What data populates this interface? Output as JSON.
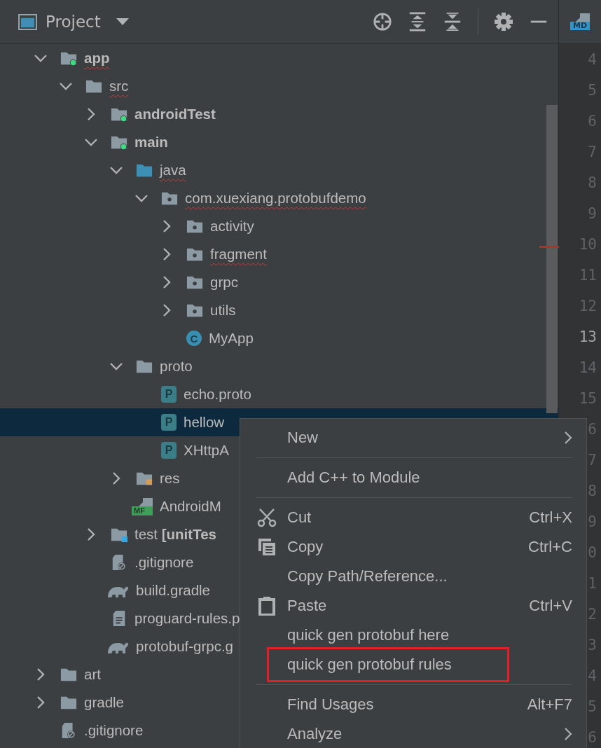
{
  "panel": {
    "title": "Project",
    "editor_tab_badge": "MD"
  },
  "tree": [
    {
      "label": "app",
      "kind": "module",
      "bold": true,
      "misspelled": true,
      "expanded": true,
      "selected": false,
      "children": [
        {
          "label": "src",
          "kind": "folder",
          "bold": false,
          "misspelled": true,
          "expanded": true,
          "selected": false,
          "children": [
            {
              "label": "androidTest",
              "kind": "module",
              "bold": true,
              "misspelled": false,
              "expanded": false,
              "selected": false
            },
            {
              "label": "main",
              "kind": "module",
              "bold": true,
              "misspelled": false,
              "expanded": true,
              "selected": false,
              "children": [
                {
                  "label": "java",
                  "kind": "source",
                  "bold": false,
                  "misspelled": true,
                  "expanded": true,
                  "selected": false,
                  "children": [
                    {
                      "label": "com.xuexiang.protobufdemo",
                      "kind": "package",
                      "bold": false,
                      "misspelled": true,
                      "expanded": true,
                      "selected": false,
                      "children": [
                        {
                          "label": "activity",
                          "kind": "package",
                          "bold": false,
                          "misspelled": false,
                          "expanded": false,
                          "selected": false
                        },
                        {
                          "label": "fragment",
                          "kind": "package",
                          "bold": false,
                          "misspelled": true,
                          "expanded": false,
                          "selected": false
                        },
                        {
                          "label": "grpc",
                          "kind": "package",
                          "bold": false,
                          "misspelled": false,
                          "expanded": false,
                          "selected": false
                        },
                        {
                          "label": "utils",
                          "kind": "package",
                          "bold": false,
                          "misspelled": false,
                          "expanded": false,
                          "selected": false
                        },
                        {
                          "label": "MyApp",
                          "kind": "class",
                          "badge": "C",
                          "bold": false,
                          "misspelled": false,
                          "selected": false
                        }
                      ]
                    }
                  ]
                },
                {
                  "label": "proto",
                  "kind": "folder",
                  "bold": false,
                  "misspelled": false,
                  "expanded": true,
                  "selected": false,
                  "children": [
                    {
                      "label": "echo.proto",
                      "kind": "proto",
                      "badge": "P",
                      "bold": false,
                      "misspelled": false,
                      "selected": false
                    },
                    {
                      "label": "hellow",
                      "kind": "proto",
                      "badge": "P",
                      "bold": false,
                      "misspelled": false,
                      "selected": true
                    },
                    {
                      "label": "XHttpA",
                      "kind": "proto",
                      "badge": "P",
                      "bold": false,
                      "misspelled": false,
                      "selected": false
                    }
                  ]
                },
                {
                  "label": "res",
                  "kind": "res",
                  "bold": false,
                  "misspelled": false,
                  "expanded": false,
                  "selected": false
                },
                {
                  "label": "AndroidM",
                  "kind": "manifest",
                  "badge": "MF",
                  "bold": false,
                  "misspelled": false,
                  "selected": false
                }
              ]
            },
            {
              "label": "test **[unitTes**",
              "kind": "test",
              "bold": false,
              "misspelled": false,
              "expanded": false,
              "selected": false
            },
            {
              "label": ".gitignore",
              "kind": "ignore",
              "bold": false,
              "misspelled": false,
              "selected": false
            },
            {
              "label": "build.gradle",
              "kind": "gradle",
              "bold": false,
              "misspelled": false,
              "selected": false
            },
            {
              "label": "proguard-rules.p",
              "kind": "text",
              "bold": false,
              "misspelled": false,
              "selected": false
            },
            {
              "label": "protobuf-grpc.g",
              "kind": "gradle",
              "bold": false,
              "misspelled": false,
              "selected": false
            }
          ]
        }
      ]
    },
    {
      "label": "art",
      "kind": "folder",
      "bold": false,
      "misspelled": false,
      "expanded": false,
      "selected": false
    },
    {
      "label": "gradle",
      "kind": "folder",
      "bold": false,
      "misspelled": false,
      "expanded": false,
      "selected": false
    },
    {
      "label": ".gitignore",
      "kind": "ignore",
      "bold": false,
      "misspelled": false,
      "selected": false
    }
  ],
  "gutter": [
    {
      "number": "4",
      "current": false
    },
    {
      "number": "5",
      "current": false
    },
    {
      "number": "6",
      "current": false
    },
    {
      "number": "7",
      "current": false
    },
    {
      "number": "8",
      "current": false
    },
    {
      "number": "9",
      "current": false
    },
    {
      "number": "10",
      "current": false
    },
    {
      "number": "11",
      "current": false
    },
    {
      "number": "12",
      "current": false
    },
    {
      "number": "13",
      "current": true
    },
    {
      "number": "14",
      "current": false
    },
    {
      "number": "15",
      "current": false
    },
    {
      "number": "6",
      "current": false
    },
    {
      "number": "7",
      "current": false
    },
    {
      "number": "8",
      "current": false
    },
    {
      "number": "9",
      "current": false
    },
    {
      "number": "0",
      "current": false
    },
    {
      "number": "1",
      "current": false
    },
    {
      "number": "2",
      "current": false
    },
    {
      "number": "3",
      "current": false
    },
    {
      "number": "4",
      "current": false
    },
    {
      "number": "5",
      "current": false
    },
    {
      "number": "6",
      "current": false
    }
  ],
  "context_menu": [
    {
      "kind": "item",
      "label": "New",
      "submenu": true,
      "outlined": false
    },
    {
      "kind": "separator"
    },
    {
      "kind": "item",
      "label": "Add C++ to Module",
      "submenu": false,
      "outlined": false
    },
    {
      "kind": "separator"
    },
    {
      "kind": "scissors_item",
      "label": "Cut",
      "shortcut": "Ctrl+X",
      "submenu": false,
      "outlined": false
    },
    {
      "kind": "copy_item",
      "label": "Copy",
      "shortcut": "Ctrl+C",
      "submenu": false,
      "outlined": false
    },
    {
      "kind": "item",
      "label": "Copy Path/Reference...",
      "submenu": false,
      "outlined": false
    },
    {
      "kind": "paste_item",
      "label": "Paste",
      "shortcut": "Ctrl+V",
      "submenu": false,
      "outlined": false
    },
    {
      "kind": "item",
      "label": "quick gen protobuf here",
      "submenu": false,
      "outlined": false
    },
    {
      "kind": "item",
      "label": "quick gen protobuf rules",
      "submenu": false,
      "outlined": true
    },
    {
      "kind": "separator"
    },
    {
      "kind": "item",
      "label": "Find Usages",
      "shortcut": "Alt+F7",
      "submenu": false,
      "outlined": false
    },
    {
      "kind": "item",
      "label": "Analyze",
      "submenu": true,
      "outlined": false
    }
  ]
}
